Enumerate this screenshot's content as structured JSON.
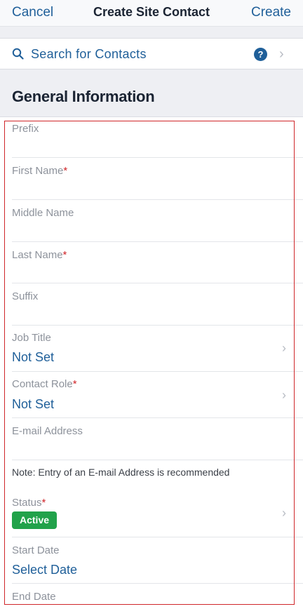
{
  "nav": {
    "cancel": "Cancel",
    "title": "Create Site Contact",
    "create": "Create"
  },
  "search": {
    "label": "Search for Contacts",
    "help_icon": "?"
  },
  "section": {
    "title": "General Information"
  },
  "fields": {
    "prefix": "Prefix",
    "first_name": "First Name",
    "middle_name": "Middle Name",
    "last_name": "Last Name",
    "suffix": "Suffix",
    "job_title": "Job Title",
    "job_title_value": "Not Set",
    "contact_role": "Contact Role",
    "contact_role_value": "Not Set",
    "email": "E-mail Address",
    "status": "Status",
    "status_value": "Active",
    "start_date": "Start Date",
    "start_date_value": "Select Date",
    "end_date": "End Date"
  },
  "required_mark": "*",
  "note": "Note: Entry of an E-mail Address is recommended",
  "colors": {
    "accent": "#1f5f99",
    "required": "#d0262a",
    "active_badge": "#21a24a"
  }
}
